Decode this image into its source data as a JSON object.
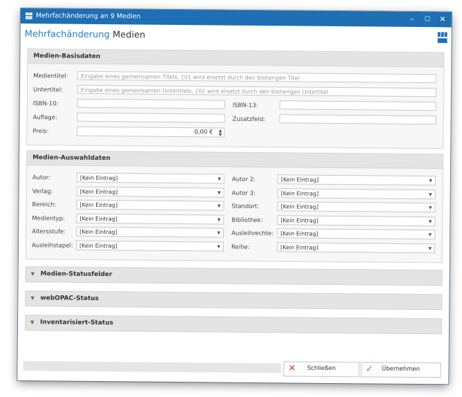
{
  "window": {
    "title": "Mehrfachänderung an 9 Medien",
    "controls": {
      "minimize": "–",
      "maximize": "☐",
      "close": "✕"
    }
  },
  "header": {
    "title_part1": "Mehrfachänderung",
    "title_part2": "Medien",
    "accent": "#1e7bc9"
  },
  "basisdaten": {
    "heading": "Medien-Basisdaten",
    "medientitel_label": "Medientitel:",
    "medientitel_placeholder": "Eingabe eines gemeinsamen Titels, {0} wird ersetzt durch den bisherigen Titel",
    "untertitel_label": "Untertitel:",
    "untertitel_placeholder": "Eingabe eines gemeinsamen Untertitels, {0} wird ersetzt durch den bisherigen Untertitel",
    "isbn10_label": "ISBN-10:",
    "isbn13_label": "ISBN-13:",
    "auflage_label": "Auflage:",
    "zusatzfeld_label": "Zusatzfeld:",
    "preis_label": "Preis:",
    "preis_value": "0,00 €"
  },
  "auswahldaten": {
    "heading": "Medien-Auswahldaten",
    "left": [
      {
        "label": "Autor:",
        "value": "[Kein Eintrag]"
      },
      {
        "label": "Verlag:",
        "value": "[Kein Eintrag]"
      },
      {
        "label": "Bereich:",
        "value": "[Kein Eintrag]"
      },
      {
        "label": "Medientyp:",
        "value": "[Kein Eintrag]"
      },
      {
        "label": "Altersstufe:",
        "value": "[Kein Eintrag]"
      },
      {
        "label": "Ausleihstapel:",
        "value": "[Kein Eintrag]"
      }
    ],
    "right": [
      {
        "label": "Autor 2:",
        "value": "[Kein Eintrag]"
      },
      {
        "label": "Autor 3:",
        "value": "[Kein Eintrag]"
      },
      {
        "label": "Standort:",
        "value": "[Kein Eintrag]"
      },
      {
        "label": "Bibliothek:",
        "value": "[Kein Eintrag]"
      },
      {
        "label": "Ausleihrechte:",
        "value": "[Kein Eintrag]"
      },
      {
        "label": "Reihe:",
        "value": "[Kein Eintrag]"
      }
    ]
  },
  "collapsed_groups": [
    "Medien-Statusfelder",
    "webOPAC-Status",
    "Inventarisiert-Status"
  ],
  "buttons": {
    "close_label": "Schließen",
    "apply_label": "Übernehmen"
  },
  "colors": {
    "titlebar": "#1e6fb4",
    "close_icon": "#e0403a",
    "apply_icon": "#3aa84a"
  }
}
